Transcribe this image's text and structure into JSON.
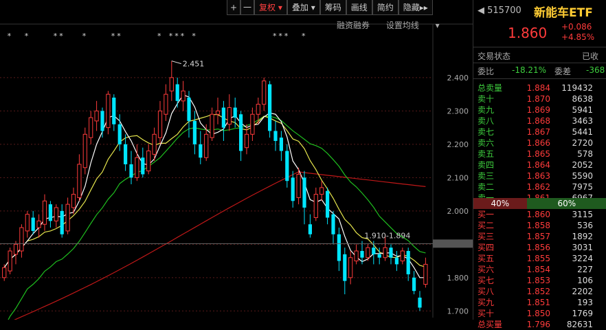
{
  "toolbar": {
    "plus": "+",
    "minus": "一",
    "fuquan": "复权",
    "diejia": "叠加",
    "choumа": "筹码",
    "huaxian": "画线",
    "jianyue": "简约",
    "yincang": "隐藏",
    "arrows": "▸▸"
  },
  "subbar": {
    "rzrq": "融资融券",
    "ma_settings": "设置均线"
  },
  "chart_data": {
    "type": "candlestick",
    "y_ticks": [
      "2.400",
      "2.300",
      "2.200",
      "2.100",
      "2.000",
      "1.900",
      "1.800",
      "1.700"
    ],
    "ylim": [
      1.68,
      2.54
    ],
    "high_annotation": "2.451",
    "range_annotation": "1.910-1.894",
    "current_line": 1.902,
    "candles": [
      [
        1.8,
        1.83,
        1.79,
        1.84
      ],
      [
        1.82,
        1.88,
        1.81,
        1.89
      ],
      [
        1.87,
        1.9,
        1.84,
        1.91
      ],
      [
        1.88,
        1.95,
        1.86,
        1.96
      ],
      [
        1.94,
        1.99,
        1.92,
        2.0
      ],
      [
        1.98,
        1.94,
        1.93,
        2.0
      ],
      [
        1.95,
        1.97,
        1.92,
        1.99
      ],
      [
        1.96,
        2.03,
        1.94,
        2.05
      ],
      [
        2.02,
        1.97,
        1.95,
        2.03
      ],
      [
        1.97,
        2.01,
        1.95,
        2.02
      ],
      [
        2.0,
        1.93,
        1.92,
        2.02
      ],
      [
        1.94,
        2.02,
        1.93,
        2.04
      ],
      [
        2.01,
        2.05,
        1.99,
        2.07
      ],
      [
        2.04,
        2.14,
        2.03,
        2.17
      ],
      [
        2.13,
        2.23,
        2.11,
        2.25
      ],
      [
        2.22,
        2.28,
        2.2,
        2.3
      ],
      [
        2.27,
        2.3,
        2.24,
        2.33
      ],
      [
        2.3,
        2.24,
        2.22,
        2.31
      ],
      [
        2.25,
        2.35,
        2.23,
        2.36
      ],
      [
        2.34,
        2.26,
        2.24,
        2.35
      ],
      [
        2.26,
        2.2,
        2.18,
        2.29
      ],
      [
        2.2,
        2.14,
        2.12,
        2.23
      ],
      [
        2.14,
        2.1,
        2.08,
        2.18
      ],
      [
        2.1,
        2.16,
        2.09,
        2.2
      ],
      [
        2.16,
        2.11,
        2.1,
        2.19
      ],
      [
        2.12,
        2.18,
        2.11,
        2.2
      ],
      [
        2.17,
        2.23,
        2.15,
        2.25
      ],
      [
        2.22,
        2.3,
        2.2,
        2.33
      ],
      [
        2.29,
        2.35,
        2.27,
        2.38
      ],
      [
        2.36,
        2.4,
        2.33,
        2.45
      ],
      [
        2.38,
        2.33,
        2.31,
        2.4
      ],
      [
        2.33,
        2.36,
        2.3,
        2.39
      ],
      [
        2.34,
        2.27,
        2.22,
        2.36
      ],
      [
        2.27,
        2.2,
        2.17,
        2.3
      ],
      [
        2.2,
        2.16,
        2.14,
        2.24
      ],
      [
        2.16,
        2.23,
        2.15,
        2.26
      ],
      [
        2.22,
        2.29,
        2.21,
        2.31
      ],
      [
        2.29,
        2.3,
        2.26,
        2.34
      ],
      [
        2.31,
        2.25,
        2.21,
        2.33
      ],
      [
        2.26,
        2.31,
        2.24,
        2.35
      ],
      [
        2.31,
        2.28,
        2.25,
        2.34
      ],
      [
        2.29,
        2.18,
        2.15,
        2.3
      ],
      [
        2.19,
        2.23,
        2.17,
        2.26
      ],
      [
        2.23,
        2.29,
        2.21,
        2.31
      ],
      [
        2.29,
        2.32,
        2.26,
        2.34
      ],
      [
        2.32,
        2.39,
        2.3,
        2.4
      ],
      [
        2.38,
        2.24,
        2.22,
        2.39
      ],
      [
        2.24,
        2.21,
        2.18,
        2.27
      ],
      [
        2.22,
        2.18,
        2.15,
        2.24
      ],
      [
        2.18,
        2.09,
        2.07,
        2.2
      ],
      [
        2.1,
        2.03,
        2.01,
        2.12
      ],
      [
        2.04,
        2.11,
        2.02,
        2.13
      ],
      [
        2.1,
        2.01,
        1.96,
        2.12
      ],
      [
        1.96,
        1.93,
        1.92,
        1.99
      ],
      [
        1.98,
        2.05,
        1.97,
        2.07
      ],
      [
        2.05,
        2.07,
        2.03,
        2.09
      ],
      [
        2.06,
        1.98,
        1.96,
        2.07
      ],
      [
        1.99,
        1.93,
        1.9,
        2.0
      ],
      [
        1.93,
        1.85,
        1.82,
        1.95
      ],
      [
        1.87,
        1.79,
        1.75,
        1.89
      ],
      [
        1.8,
        1.86,
        1.78,
        1.88
      ],
      [
        1.85,
        1.88,
        1.84,
        1.9
      ],
      [
        1.88,
        1.86,
        1.84,
        1.91
      ],
      [
        1.86,
        1.89,
        1.85,
        1.9
      ],
      [
        1.89,
        1.87,
        1.84,
        1.91
      ],
      [
        1.87,
        1.86,
        1.84,
        1.89
      ],
      [
        1.86,
        1.89,
        1.85,
        1.93
      ],
      [
        1.89,
        1.86,
        1.84,
        1.9
      ],
      [
        1.86,
        1.84,
        1.82,
        1.88
      ],
      [
        1.85,
        1.88,
        1.84,
        1.89
      ],
      [
        1.88,
        1.81,
        1.79,
        1.89
      ],
      [
        1.8,
        1.76,
        1.75,
        1.82
      ],
      [
        1.74,
        1.71,
        1.7,
        1.76
      ],
      [
        1.78,
        1.84,
        1.77,
        1.86
      ]
    ]
  },
  "side": {
    "code": "515700",
    "name": "新能车ETF",
    "price": "1.860",
    "change": "+0.086",
    "change_pct": "+4.85%",
    "status_label": "交易状态",
    "status_value": "已收",
    "weibi_label": "委比",
    "weibi_value": "-18.21%",
    "weicha_label": "委差",
    "weicha_value": "-368",
    "sell_total": {
      "label": "总卖量",
      "price": "1.884",
      "vol": "119432"
    },
    "asks": [
      {
        "label": "卖十",
        "price": "1.870",
        "vol": "8638"
      },
      {
        "label": "卖九",
        "price": "1.869",
        "vol": "5941"
      },
      {
        "label": "卖八",
        "price": "1.868",
        "vol": "3463"
      },
      {
        "label": "卖七",
        "price": "1.867",
        "vol": "5441"
      },
      {
        "label": "卖六",
        "price": "1.866",
        "vol": "2720"
      },
      {
        "label": "卖五",
        "price": "1.865",
        "vol": "578"
      },
      {
        "label": "卖四",
        "price": "1.864",
        "vol": "2052"
      },
      {
        "label": "卖三",
        "price": "1.863",
        "vol": "5590"
      },
      {
        "label": "卖二",
        "price": "1.862",
        "vol": "7975"
      },
      {
        "label": "卖一",
        "price": "1.861",
        "vol": "6967"
      }
    ],
    "ratio_left": "40%",
    "ratio_right": "60%",
    "bids": [
      {
        "label": "买一",
        "price": "1.860",
        "vol": "3115"
      },
      {
        "label": "买二",
        "price": "1.858",
        "vol": "536"
      },
      {
        "label": "买三",
        "price": "1.857",
        "vol": "1892"
      },
      {
        "label": "买四",
        "price": "1.856",
        "vol": "3031"
      },
      {
        "label": "买五",
        "price": "1.855",
        "vol": "3224"
      },
      {
        "label": "买六",
        "price": "1.854",
        "vol": "227"
      },
      {
        "label": "买七",
        "price": "1.853",
        "vol": "106"
      },
      {
        "label": "买八",
        "price": "1.852",
        "vol": "2202"
      },
      {
        "label": "买九",
        "price": "1.851",
        "vol": "193"
      },
      {
        "label": "买十",
        "price": "1.850",
        "vol": "1769"
      }
    ],
    "buy_total": {
      "label": "总买量",
      "price": "1.796",
      "vol": "82631"
    }
  },
  "colors": {
    "up": "#ff3b3b",
    "down": "#00e5ff",
    "ma5": "#ffffff",
    "ma10": "#e6e64d",
    "ma20": "#1fbf1f",
    "ma60": "#c01818"
  }
}
